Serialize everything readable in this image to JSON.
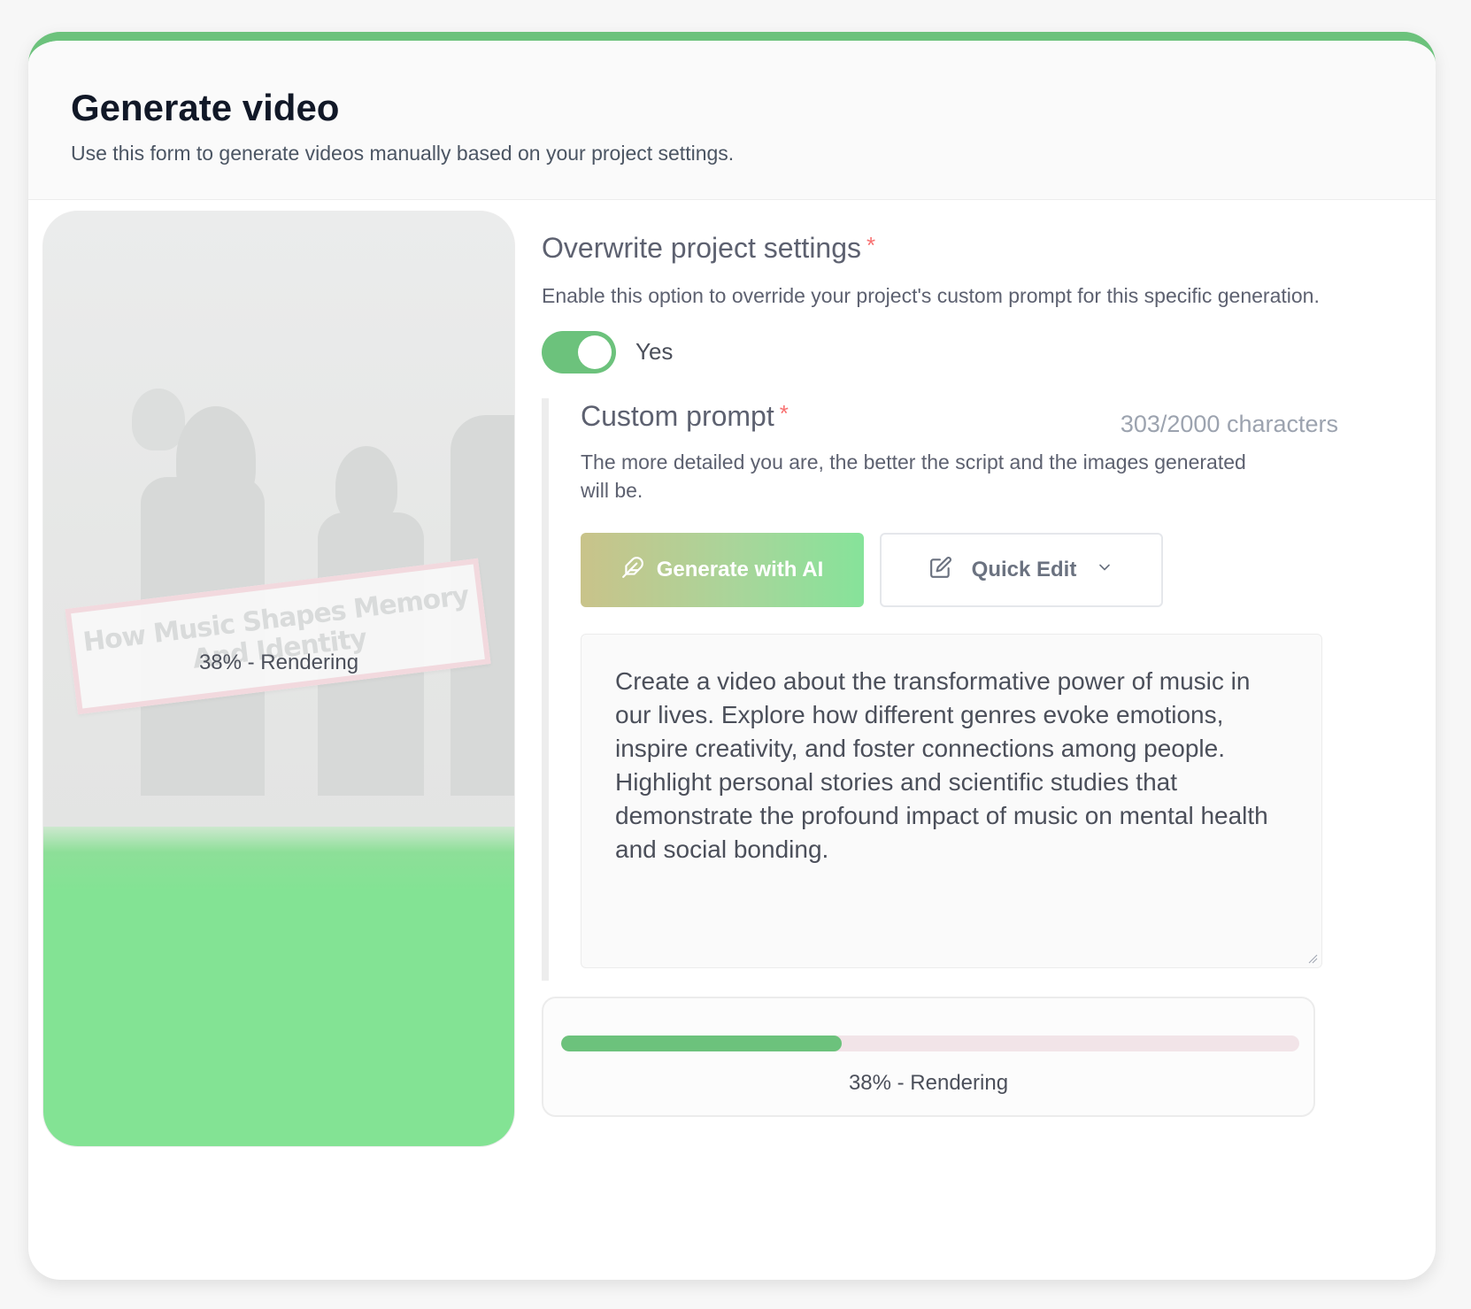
{
  "header": {
    "title": "Generate video",
    "subtitle": "Use this form to generate videos manually based on your project settings."
  },
  "preview": {
    "banner_text": "How Music Shapes Memory And Identity",
    "status_text": "38% - Rendering"
  },
  "overwrite": {
    "title": "Overwrite project settings",
    "required_mark": "*",
    "description": "Enable this option to override your project's custom prompt for this specific generation.",
    "toggle_on": true,
    "toggle_label": "Yes"
  },
  "custom_prompt": {
    "title": "Custom prompt",
    "required_mark": "*",
    "counter": "303/2000 characters",
    "description": "The more detailed you are, the better the script and the images generated will be.",
    "generate_button_label": "Generate with AI",
    "generate_button_icon": "feather-icon",
    "quick_edit_label": "Quick Edit",
    "quick_edit_icon": "edit-icon",
    "quick_edit_chevron": "chevron-down-icon",
    "prompt_text": "Create a video about the transformative power of music in our lives. Explore how different genres evoke emotions, inspire creativity, and foster connections among people. Highlight personal stories and scientific studies that demonstrate the profound impact of music on mental health and social bonding."
  },
  "progress": {
    "percent": 38,
    "label": "38% - Rendering"
  },
  "colors": {
    "accent_green": "#6cc27c",
    "preview_green": "#83e394",
    "required_red": "#f87171",
    "progress_track": "#f2e4e8"
  }
}
